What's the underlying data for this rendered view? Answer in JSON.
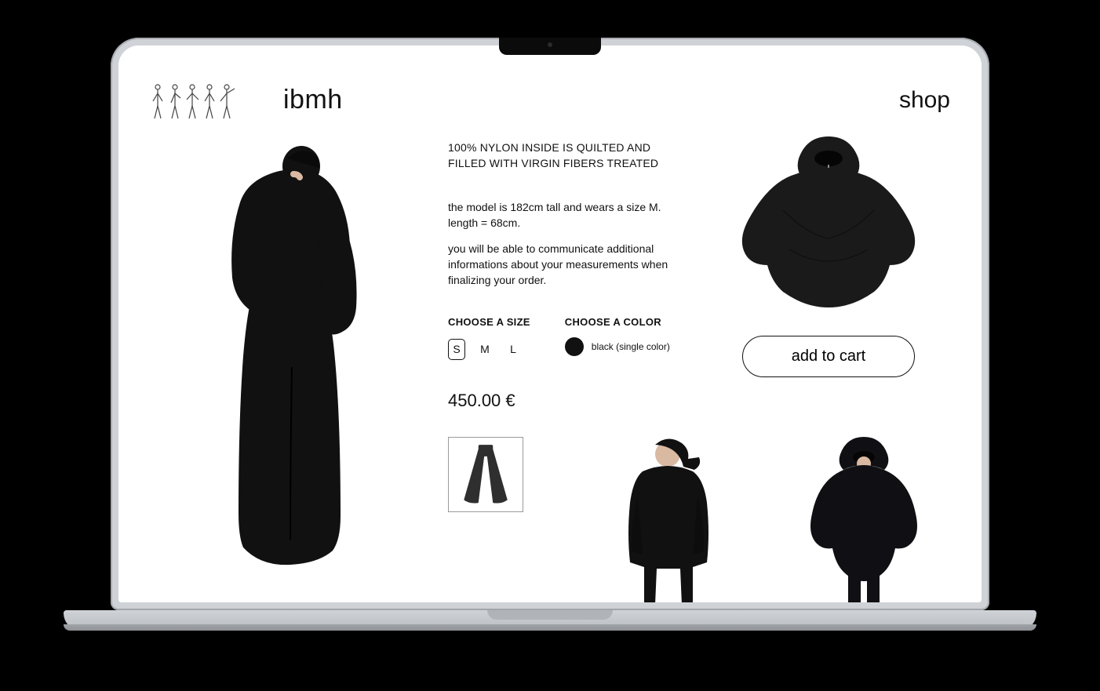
{
  "header": {
    "brand": "ibmh",
    "shopLink": "shop"
  },
  "product": {
    "materialLine": "100% NYLON INSIDE IS QUILTED AND FILLED WITH VIRGIN FIBERS TREATED",
    "fitLine": "the model is 182cm tall and wears a size M. length = 68cm.",
    "noteLine": "you will be able to communicate additional informations about your measurements when finalizing your order.",
    "sizeHeading": "CHOOSE A SIZE",
    "colorHeading": "CHOOSE A COLOR",
    "sizes": {
      "s": "S",
      "m": "M",
      "l": "L"
    },
    "selectedSize": "S",
    "colorName": "black (single color)",
    "colorHex": "#111111",
    "price": "450.00 €",
    "cartLabel": "add to cart"
  }
}
